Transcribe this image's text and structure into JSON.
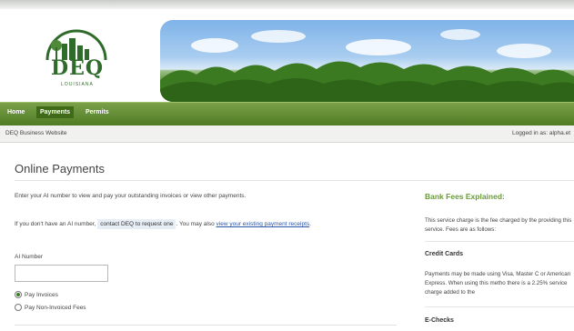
{
  "header": {
    "logo_text": "DEQ",
    "logo_sub": "LOUISIANA"
  },
  "nav": {
    "items": [
      "Home",
      "Payments",
      "Permits"
    ],
    "active": "Payments"
  },
  "subbar": {
    "site_name": "DEQ Business Website",
    "logged_in": "Logged in as: alpha.et"
  },
  "main": {
    "title": "Online Payments",
    "intro": "Enter your AI number to view and pay your outstanding invoices or view other payments.",
    "no_ai_prefix": "If you don't have an AI number,",
    "contact_link": "contact DEQ to request one",
    "you_may_also": ". You may also",
    "receipts_link": "view your existing payment receipts",
    "receipts_suffix": ".",
    "ai_label": "AI Number",
    "ai_value": "",
    "options": [
      {
        "label": "Pay Invoices",
        "checked": true
      },
      {
        "label": "Pay Non-Invoiced Fees",
        "checked": false
      }
    ]
  },
  "side": {
    "heading": "Bank Fees Explained:",
    "intro": "This service charge is the fee charged by the providing this service. Fees are as follows:",
    "credit_heading": "Credit Cards",
    "credit_text": "Payments may be made using Visa, Master C or American Express. When using this metho there is a 2.25% service charge added to the",
    "echeck_heading": "E-Checks"
  },
  "colors": {
    "nav_green": "#4d7a22",
    "accent_green": "#6a9a3a",
    "link_blue": "#2a55a8"
  }
}
